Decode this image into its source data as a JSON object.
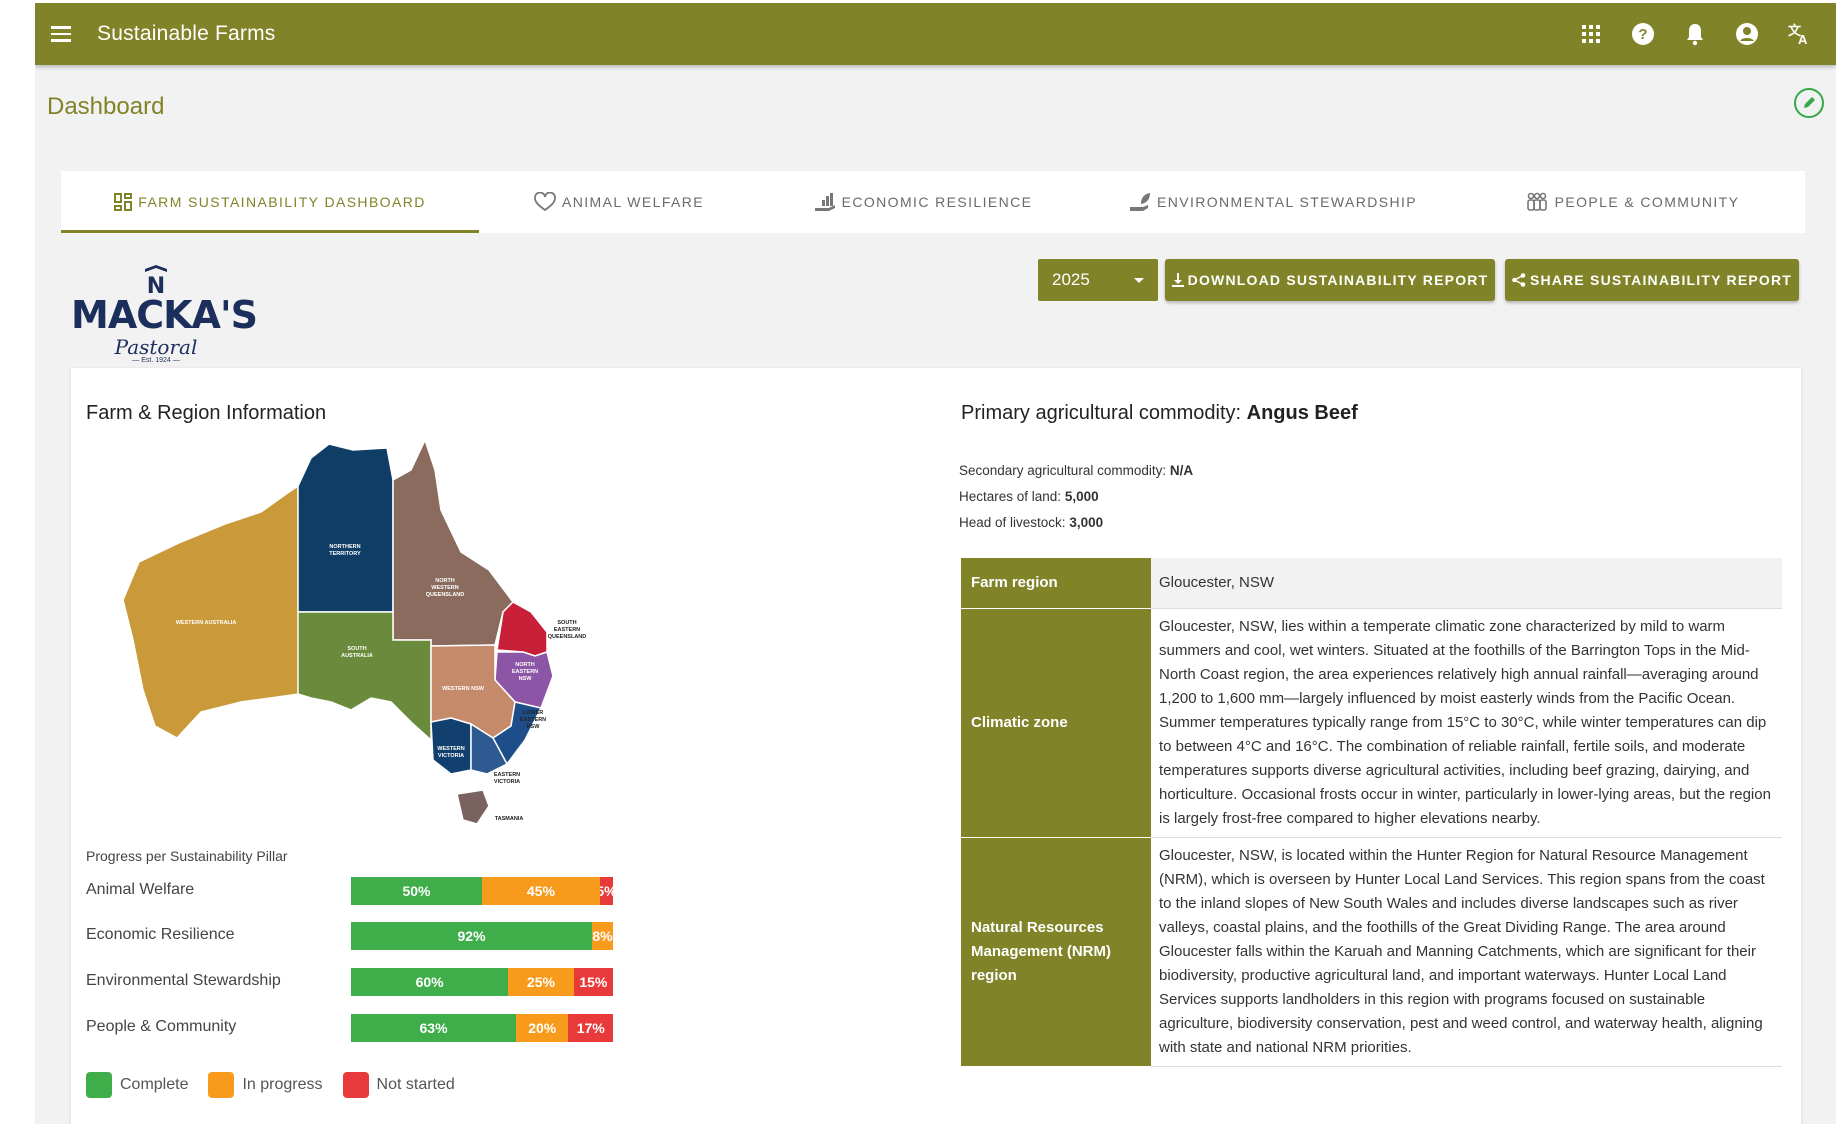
{
  "app": {
    "title": "Sustainable Farms"
  },
  "toolbar_icons": [
    "apps-grid-icon",
    "help-icon",
    "notifications-bell-icon",
    "account-icon",
    "translate-icon"
  ],
  "page": {
    "title": "Dashboard"
  },
  "tabs": [
    {
      "label": "Farm Sustainability Dashboard",
      "icon": "dashboard-icon",
      "active": true
    },
    {
      "label": "Animal Welfare",
      "icon": "heart-shield-icon",
      "active": false
    },
    {
      "label": "Economic Resilience",
      "icon": "growth-hand-icon",
      "active": false
    },
    {
      "label": "Environmental Stewardship",
      "icon": "plant-hand-icon",
      "active": false
    },
    {
      "label": "People & Community",
      "icon": "group-icon",
      "active": false
    }
  ],
  "logo": {
    "brand": "MACKA'S",
    "sub": "Pastoral",
    "est": "— Est. 1924 —"
  },
  "controls": {
    "year": "2025",
    "download_label": "Download Sustainability Report",
    "share_label": "Share Sustainability Report"
  },
  "farm_info": {
    "title": "Farm & Region Information"
  },
  "map": {
    "regions": {
      "western_australia": "WESTERN AUSTRALIA",
      "northern_territory": [
        "NORTHERN",
        "TERRITORY"
      ],
      "north_western_queensland": [
        "NORTH",
        "WESTERN",
        "QUEENSLAND"
      ],
      "south_eastern_queensland": [
        "SOUTH",
        "EASTERN",
        "QUEENSLAND"
      ],
      "south_australia": [
        "SOUTH",
        "AUSTRALIA"
      ],
      "north_eastern_nsw": [
        "NORTH",
        "EASTERN",
        "NSW"
      ],
      "western_nsw": "WESTERN NSW",
      "lower_eastern_nsw": [
        "LOWER",
        "EASTERN",
        "NSW"
      ],
      "western_victoria": [
        "WESTERN",
        "VICTORIA"
      ],
      "eastern_victoria": [
        "EASTERN",
        "VICTORIA"
      ],
      "tasmania": "TASMANIA"
    },
    "colors": {
      "wa": "#c9993a",
      "nt": "#0f3d66",
      "nwq": "#8a6b5e",
      "seq": "#c9203a",
      "sa": "#6a8a3c",
      "nen": "#8c55a6",
      "wn": "#c48a6a",
      "len": "#1d4e89",
      "wv": "#12406e",
      "ev": "#2d5a91",
      "tas": "#7a6260"
    }
  },
  "progress": {
    "title": "Progress per Sustainability Pillar",
    "pillars": [
      {
        "name": "Animal Welfare",
        "complete": 50,
        "in_progress": 45,
        "not_started": 5,
        "labels": [
          "50%",
          "45%",
          "5%"
        ]
      },
      {
        "name": "Economic Resilience",
        "complete": 92,
        "in_progress": 8,
        "not_started": 0,
        "labels": [
          "92%",
          "8%",
          ""
        ]
      },
      {
        "name": "Environmental Stewardship",
        "complete": 60,
        "in_progress": 25,
        "not_started": 15,
        "labels": [
          "60%",
          "25%",
          "15%"
        ]
      },
      {
        "name": "People & Community",
        "complete": 63,
        "in_progress": 20,
        "not_started": 17,
        "labels": [
          "63%",
          "20%",
          "17%"
        ]
      }
    ],
    "legend": {
      "complete": "Complete",
      "in_progress": "In progress",
      "not_started": "Not started"
    },
    "colors": {
      "complete": "#3fae4a",
      "in_progress": "#f89a1c",
      "not_started": "#e83a3a"
    }
  },
  "commodity": {
    "primary_label": "Primary agricultural commodity: ",
    "primary_value": "Angus Beef",
    "secondary_label": "Secondary agricultural commodity: ",
    "secondary_value": "N/A",
    "hectares_label": "Hectares of land: ",
    "hectares_value": "5,000",
    "livestock_label": "Head of livestock: ",
    "livestock_value": "3,000"
  },
  "region_table": {
    "farm_region_label": "Farm region",
    "farm_region_value": "Gloucester, NSW",
    "climatic_zone_label": "Climatic zone",
    "climatic_zone_value": "Gloucester, NSW, lies within a temperate climatic zone characterized by mild to warm summers and cool, wet winters. Situated at the foothills of the Barrington Tops in the Mid-North Coast region, the area experiences relatively high annual rainfall—averaging around 1,200 to 1,600 mm—largely influenced by moist easterly winds from the Pacific Ocean. Summer temperatures typically range from 15°C to 30°C, while winter temperatures can dip to between 4°C and 16°C. The combination of reliable rainfall, fertile soils, and moderate temperatures supports diverse agricultural activities, including beef grazing, dairying, and horticulture. Occasional frosts occur in winter, particularly in lower-lying areas, but the region is largely frost-free compared to higher elevations nearby.",
    "nrm_label": "Natural Resources Management (NRM) region",
    "nrm_value": "Gloucester, NSW, is located within the Hunter Region for Natural Resource Management (NRM), which is overseen by Hunter Local Land Services. This region spans from the coast to the inland slopes of New South Wales and includes diverse landscapes such as river valleys, coastal plains, and the foothills of the Great Dividing Range. The area around Gloucester falls within the Karuah and Manning Catchments, which are significant for their biodiversity, productive agricultural land, and important waterways. Hunter Local Land Services supports landholders in this region with programs focused on sustainable agriculture, biodiversity conservation, pest and weed control, and waterway health, aligning with state and national NRM priorities."
  }
}
